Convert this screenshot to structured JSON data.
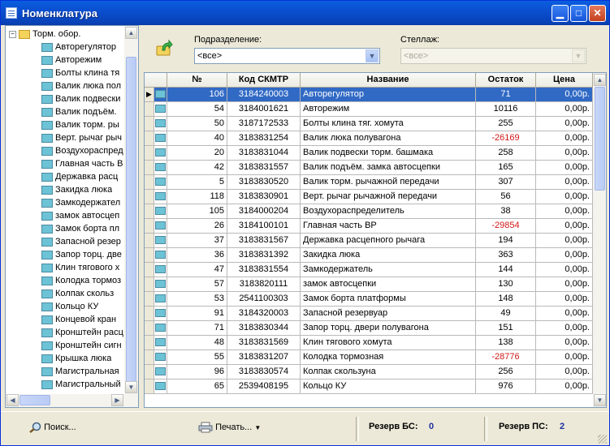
{
  "window": {
    "title": "Номенклатура"
  },
  "tree": {
    "root": "Торм. обор.",
    "items": [
      "Авторегулятор",
      "Авторежим",
      "Болты клина тя",
      "Валик люка пол",
      "Валик подвески",
      "Валик подъём.",
      "Валик торм. ры",
      "Верт. рычаг рыч",
      "Воздухораспред",
      "Главная часть В",
      "Державка расц",
      "Закидка люка",
      "Замкодержател",
      "замок автосцеп",
      "Замок борта пл",
      "Запасной резер",
      "Запор торц. две",
      "Клин тягового х",
      "Колодка тормоз",
      "Колпак скольз",
      "Кольцо КУ",
      "Концевой кран",
      "Кронштейн расц",
      "Кронштейн сигн",
      "Крышка люка",
      "Магистральная",
      "Магистральный"
    ]
  },
  "filters": {
    "subdivision_label": "Подразделение:",
    "subdivision_value": "<все>",
    "rack_label": "Стеллаж:",
    "rack_value": "<все>"
  },
  "grid": {
    "headers": [
      "№",
      "Код СКМТР",
      "Название",
      "Остаток",
      "Цена"
    ],
    "rows": [
      [
        "106",
        "3184240003",
        "Авторегулятор",
        "71",
        "0,00р."
      ],
      [
        "54",
        "3184001621",
        "Авторежим",
        "10116",
        "0,00р."
      ],
      [
        "50",
        "3187172533",
        "Болты клина тяг. хомута",
        "255",
        "0,00р."
      ],
      [
        "40",
        "3183831254",
        "Валик люка полувагона",
        "-26169",
        "0,00р."
      ],
      [
        "20",
        "3183831044",
        "Валик подвески торм. башмака",
        "258",
        "0,00р."
      ],
      [
        "42",
        "3183831557",
        "Валик подъём. замка автосцепки",
        "165",
        "0,00р."
      ],
      [
        "5",
        "3183830520",
        "Валик торм. рычажной передачи",
        "307",
        "0,00р."
      ],
      [
        "118",
        "3183830901",
        "Верт. рычаг рычажной передачи",
        "56",
        "0,00р."
      ],
      [
        "105",
        "3184000204",
        "Воздухораспределитель",
        "38",
        "0,00р."
      ],
      [
        "26",
        "3184100101",
        "Главная часть ВР",
        "-29854",
        "0,00р."
      ],
      [
        "37",
        "3183831567",
        "Державка расцепного рычага",
        "194",
        "0,00р."
      ],
      [
        "36",
        "3183831392",
        "Закидка люка",
        "363",
        "0,00р."
      ],
      [
        "47",
        "3183831554",
        "Замкодержатель",
        "144",
        "0,00р."
      ],
      [
        "57",
        "3183820111",
        "замок автосцепки",
        "130",
        "0,00р."
      ],
      [
        "53",
        "2541100303",
        "Замок борта платформы",
        "148",
        "0,00р."
      ],
      [
        "91",
        "3184320003",
        "Запасной резервуар",
        "49",
        "0,00р."
      ],
      [
        "71",
        "3183830344",
        "Запор торц. двери полувагона",
        "151",
        "0,00р."
      ],
      [
        "48",
        "3183831569",
        "Клин тягового хомута",
        "138",
        "0,00р."
      ],
      [
        "55",
        "3183831207",
        "Колодка тормозная",
        "-28776",
        "0,00р."
      ],
      [
        "96",
        "3183830574",
        "Колпак скользуна",
        "256",
        "0,00р."
      ],
      [
        "65",
        "2539408195",
        "Кольцо КУ",
        "976",
        "0,00р."
      ]
    ]
  },
  "footer": {
    "search_label": "Поиск...",
    "print_label": "Печать...",
    "reserve_bs_label": "Резерв БС:",
    "reserve_bs_value": "0",
    "reserve_ps_label": "Резерв ПС:",
    "reserve_ps_value": "2"
  },
  "colors": {
    "selection": "#316ac5",
    "negative": "#d01818",
    "titlebar": "#0a52d9"
  },
  "icons": {
    "title": "window-list-icon",
    "refresh": "refresh-arrow-icon",
    "search": "magnifier-icon",
    "print": "printer-icon"
  }
}
